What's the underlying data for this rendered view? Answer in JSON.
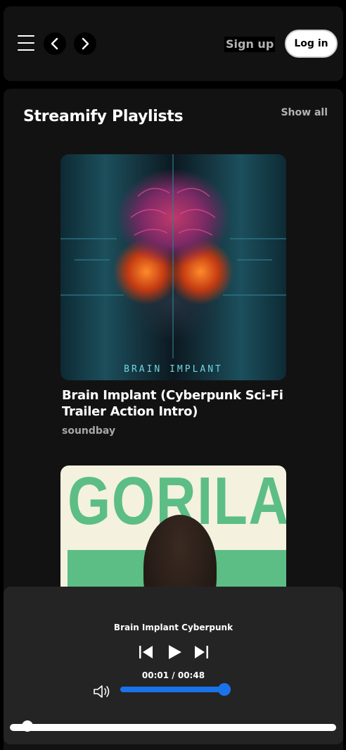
{
  "header": {
    "signup_label": "Sign up",
    "login_label": "Log in",
    "icons": [
      "menu-icon",
      "chevron-left-icon",
      "chevron-right-icon"
    ]
  },
  "section": {
    "title": "Streamify Playlists",
    "show_all_label": "Show all"
  },
  "playlists": [
    {
      "title": "Brain Implant (Cyberpunk Sci-Fi Trailer Action Intro)",
      "artist": "soundbay",
      "cover_text": "BRAIN IMPLANT"
    },
    {
      "title": "",
      "artist": "",
      "cover_text": "GORILA"
    }
  ],
  "player": {
    "track_name": "Brain Implant Cyberpunk",
    "current_time": "00:01",
    "duration": "00:48",
    "time_display": "00:01 / 00:48",
    "volume_level": 1.0,
    "progress_fraction": 0.02,
    "icons": [
      "previous-icon",
      "play-icon",
      "next-icon",
      "volume-icon"
    ],
    "accent_color": "#1a73e8"
  },
  "colors": {
    "background": "#000000",
    "panel": "#121212",
    "player_bg": "#242424",
    "muted_text": "#b3b3b3"
  }
}
